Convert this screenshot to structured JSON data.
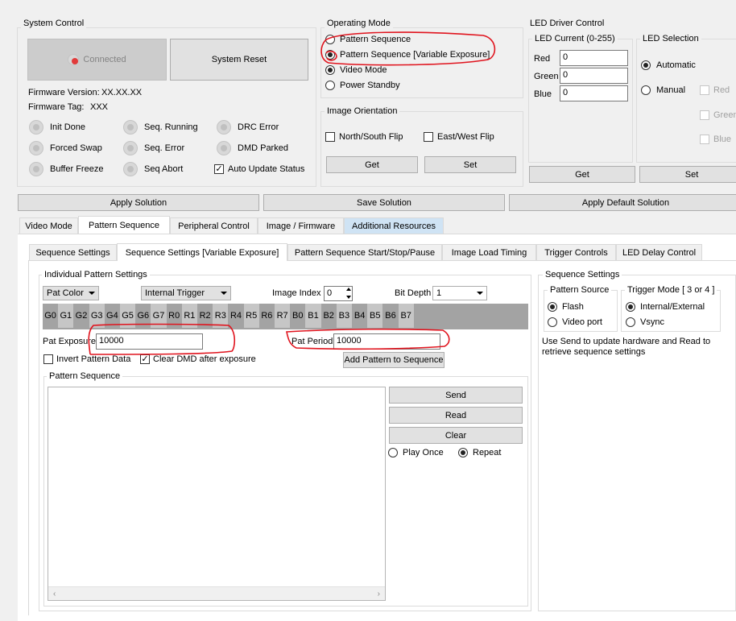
{
  "system_control": {
    "title": "System Control",
    "connected_label": "Connected",
    "reset_label": "System Reset",
    "firmware_version_label": "Firmware Version:",
    "firmware_version_value": "XX.XX.XX",
    "firmware_tag_label": "Firmware Tag:",
    "firmware_tag_value": "XXX",
    "status": [
      {
        "label": "Init Done"
      },
      {
        "label": "Seq. Running"
      },
      {
        "label": "DRC Error"
      },
      {
        "label": "Forced Swap"
      },
      {
        "label": "Seq. Error"
      },
      {
        "label": "DMD Parked"
      },
      {
        "label": "Buffer Freeze"
      },
      {
        "label": "Seq Abort"
      }
    ],
    "auto_update_label": "Auto Update Status"
  },
  "operating_mode": {
    "title": "Operating Mode",
    "options": [
      "Pattern Sequence",
      "Pattern Sequence [Variable Exposure]",
      "Video Mode",
      "Power Standby"
    ]
  },
  "image_orientation": {
    "title": "Image Orientation",
    "ns_label": "North/South Flip",
    "ew_label": "East/West Flip",
    "get_label": "Get",
    "set_label": "Set"
  },
  "led_driver": {
    "title": "LED Driver Control",
    "current_title": "LED Current (0-255)",
    "red_label": "Red",
    "red_value": "0",
    "green_label": "Green",
    "green_value": "0",
    "blue_label": "Blue",
    "blue_value": "0",
    "selection_title": "LED Selection",
    "automatic_label": "Automatic",
    "manual_label": "Manual",
    "sel_red": "Red",
    "sel_green": "Green",
    "sel_blue": "Blue",
    "get_label": "Get",
    "set_label": "Set"
  },
  "solutions": {
    "apply": "Apply Solution",
    "save": "Save Solution",
    "apply_default": "Apply Default Solution"
  },
  "main_tabs": [
    "Video Mode",
    "Pattern Sequence",
    "Peripheral Control",
    "Image / Firmware",
    "Additional Resources"
  ],
  "sub_tabs": [
    "Sequence Settings",
    "Sequence Settings [Variable Exposure]",
    "Pattern Sequence Start/Stop/Pause",
    "Image Load Timing",
    "Trigger Controls",
    "LED Delay Control"
  ],
  "individual": {
    "title": "Individual Pattern Settings",
    "pat_color": "Pat Color",
    "trigger": "Internal Trigger",
    "image_index_label": "Image Index",
    "image_index_value": "0",
    "bit_depth_label": "Bit Depth",
    "bit_depth_value": "1",
    "channels": [
      "G0",
      "G1",
      "G2",
      "G3",
      "G4",
      "G5",
      "G6",
      "G7",
      "R0",
      "R1",
      "R2",
      "R3",
      "R4",
      "R5",
      "R6",
      "R7",
      "B0",
      "B1",
      "B2",
      "B3",
      "B4",
      "B5",
      "B6",
      "B7"
    ],
    "pat_exposure_label": "Pat Exposure",
    "pat_exposure_value": "10000",
    "pat_period_label": "Pat Period",
    "pat_period_value": "10000",
    "invert_label": "Invert Pattern Data",
    "clear_dmd_label": "Clear DMD after exposure",
    "add_button": "Add Pattern to Sequence"
  },
  "pattern_sequence": {
    "title": "Pattern Sequence",
    "send": "Send",
    "read": "Read",
    "clear": "Clear",
    "play_once": "Play Once",
    "repeat": "Repeat"
  },
  "sequence_settings": {
    "title": "Sequence Settings",
    "source_title": "Pattern Source",
    "flash": "Flash",
    "video_port": "Video port",
    "trigger_title": "Trigger Mode [ 3 or 4 ]",
    "internal_external": "Internal/External",
    "vsync": "Vsync",
    "help_line1": "Use Send to update hardware and Read to",
    "help_line2": "retrieve sequence settings"
  },
  "colors": {
    "window_bg": "#f0f0f0",
    "annotation_red": "#e0141e",
    "led_on": "#e13a3a",
    "additional_tab": "#cfe3f4"
  }
}
